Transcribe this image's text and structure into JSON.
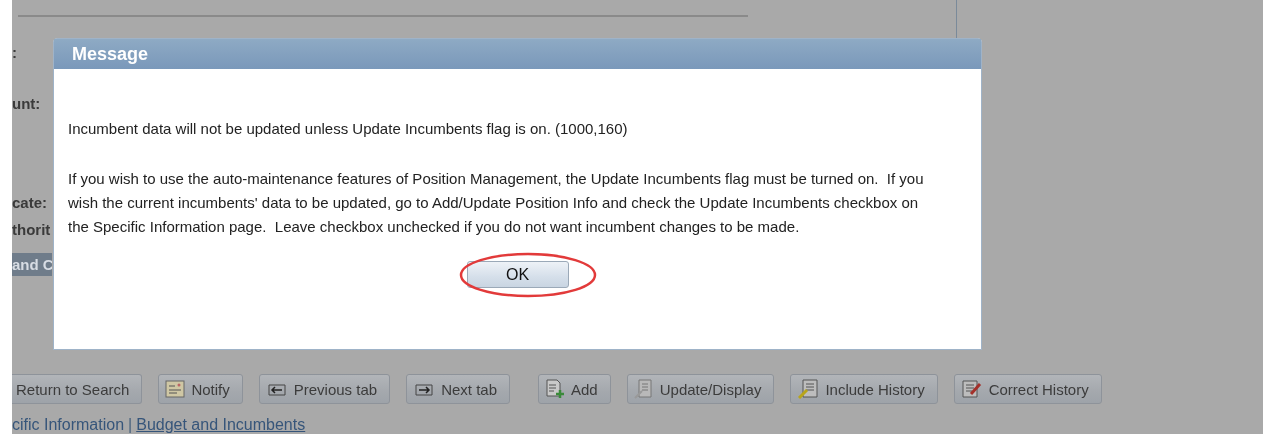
{
  "background_page": {
    "field_labels": [
      ":",
      "unt:",
      "cate:",
      "thorit"
    ],
    "section_header": "and C",
    "toolbar_buttons": [
      "Return to Search",
      "Notify",
      "Previous tab",
      "Next tab",
      "Add",
      "Update/Display",
      "Include History",
      "Correct History"
    ],
    "link_separator": "|",
    "page_links": [
      {
        "label": "cific Information",
        "link": false
      },
      {
        "label": "Budget and Incumbents",
        "link": true
      }
    ]
  },
  "dialog": {
    "title": "Message",
    "paragraphs": [
      "Incumbent data will not be updated unless Update Incumbents flag is on. (1000,160)",
      "If you wish to use the auto-maintenance features of Position Management, the Update Incumbents flag must be turned on.  If you wish the current incumbents' data to be updated, go to Add/Update Position Info and check the Update Incumbents checkbox on the Specific Information page.  Leave checkbox unchecked if you do not want incumbent changes to be made."
    ],
    "button": "OK",
    "button_highlighted": true
  }
}
